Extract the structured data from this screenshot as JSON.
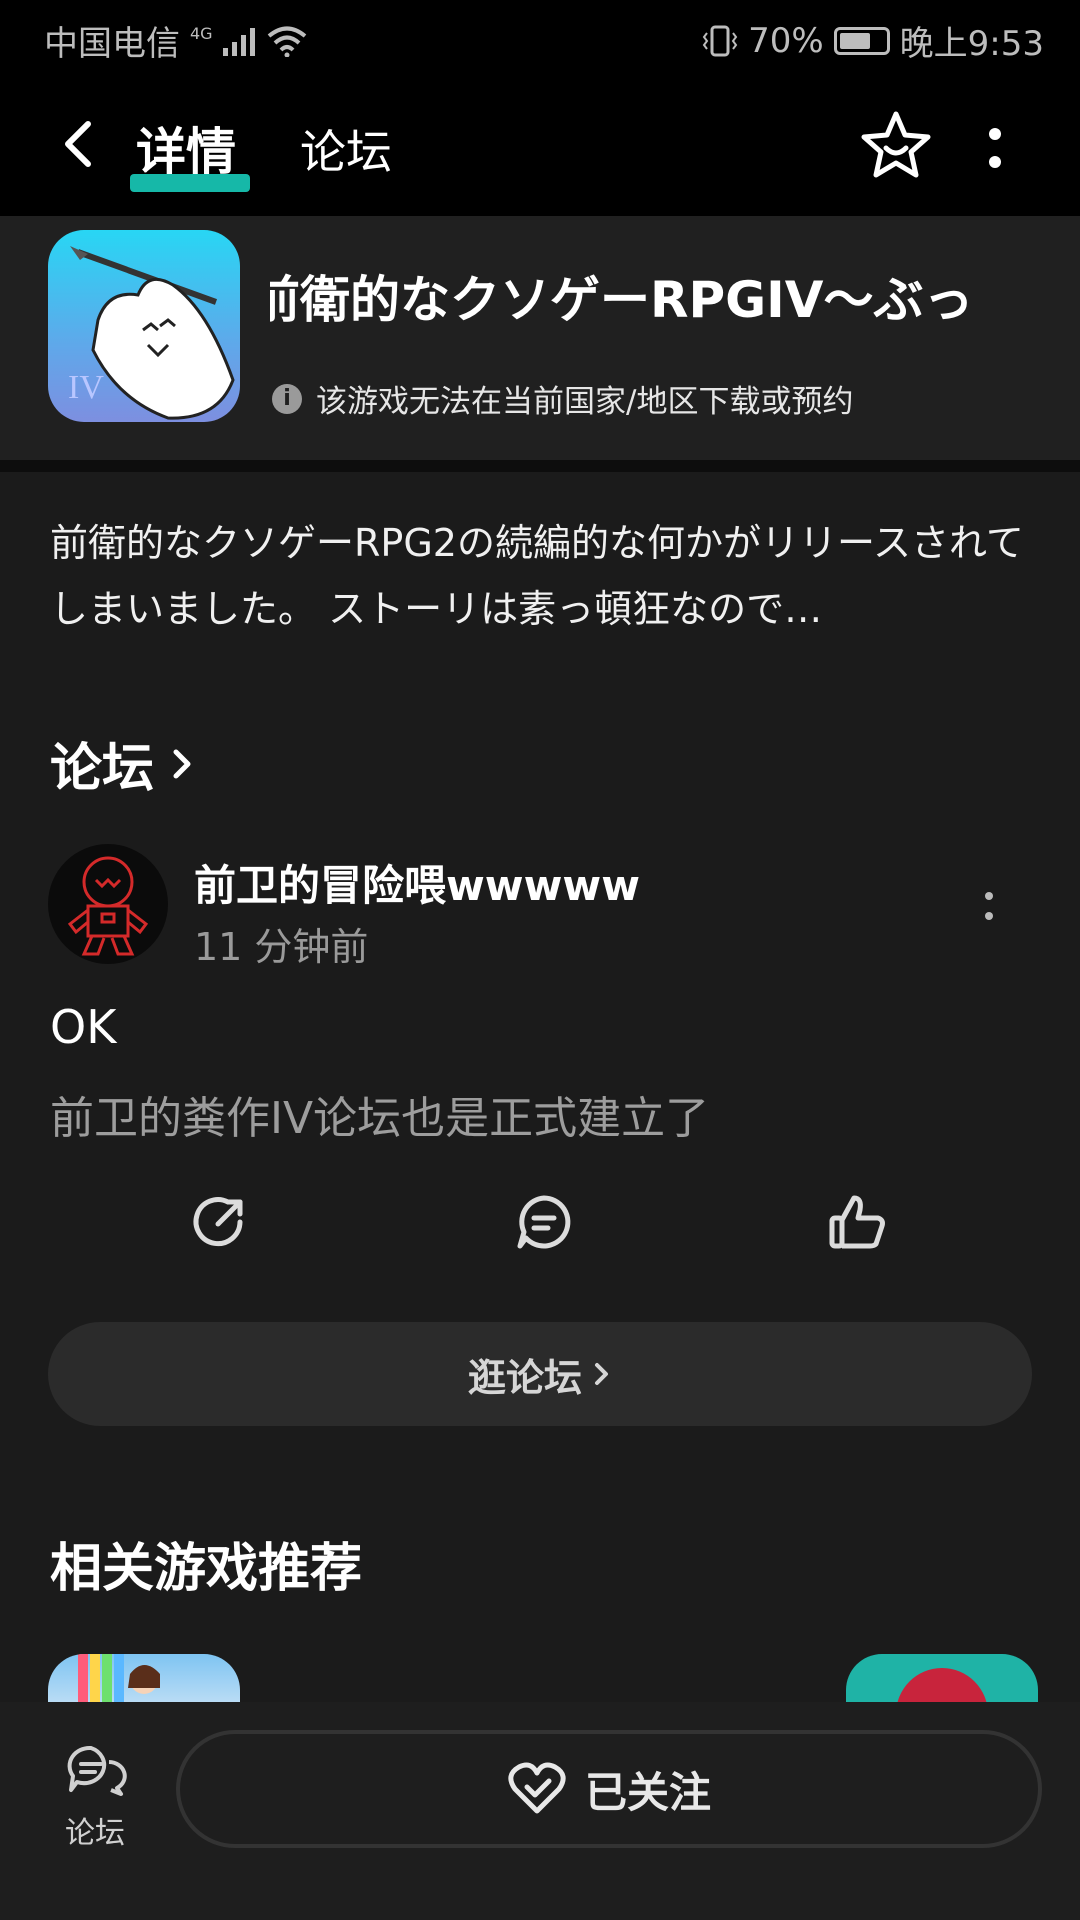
{
  "status_bar": {
    "carrier": "中国电信",
    "network": "4G",
    "battery": "70%",
    "battery_level": 0.7,
    "time": "晚上9:53"
  },
  "top_bar": {
    "tab_detail": "详情",
    "tab_forum": "论坛",
    "accent_color": "#16b8a8"
  },
  "game": {
    "title": "前衛的なクソゲーRPGIV～ぶっ",
    "region_note": "该游戏无法在当前国家/地区下载或预约",
    "icon_mark": "IV"
  },
  "description": "前衛的なクソゲーRPG2の続編的な何かがリリースされてしまいました。 ストーリは素っ頓狂なので…",
  "forum": {
    "section_title": "论坛",
    "post": {
      "author": "前卫的冒险喂wwwww",
      "time": "11 分钟前",
      "title": "OK",
      "body": "前卫的粪作IV论坛也是正式建立了"
    },
    "browse_label": "逛论坛"
  },
  "related": {
    "title": "相关游戏推荐"
  },
  "bottom_bar": {
    "forum_label": "论坛",
    "follow_label": "已关注"
  }
}
